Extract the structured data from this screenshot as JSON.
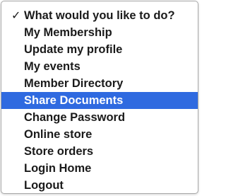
{
  "menu": {
    "items": [
      {
        "label": "What would you like to do?",
        "checked": true,
        "selected": false
      },
      {
        "label": "My Membership",
        "checked": false,
        "selected": false
      },
      {
        "label": "Update my profile",
        "checked": false,
        "selected": false
      },
      {
        "label": "My events",
        "checked": false,
        "selected": false
      },
      {
        "label": "Member Directory",
        "checked": false,
        "selected": false
      },
      {
        "label": "Share Documents",
        "checked": false,
        "selected": true
      },
      {
        "label": "Change Password",
        "checked": false,
        "selected": false
      },
      {
        "label": "Online store",
        "checked": false,
        "selected": false
      },
      {
        "label": "Store orders",
        "checked": false,
        "selected": false
      },
      {
        "label": "Login Home",
        "checked": false,
        "selected": false
      },
      {
        "label": "Logout",
        "checked": false,
        "selected": false
      }
    ],
    "check_glyph": "✓",
    "highlight_color": "#2f6ae0"
  }
}
